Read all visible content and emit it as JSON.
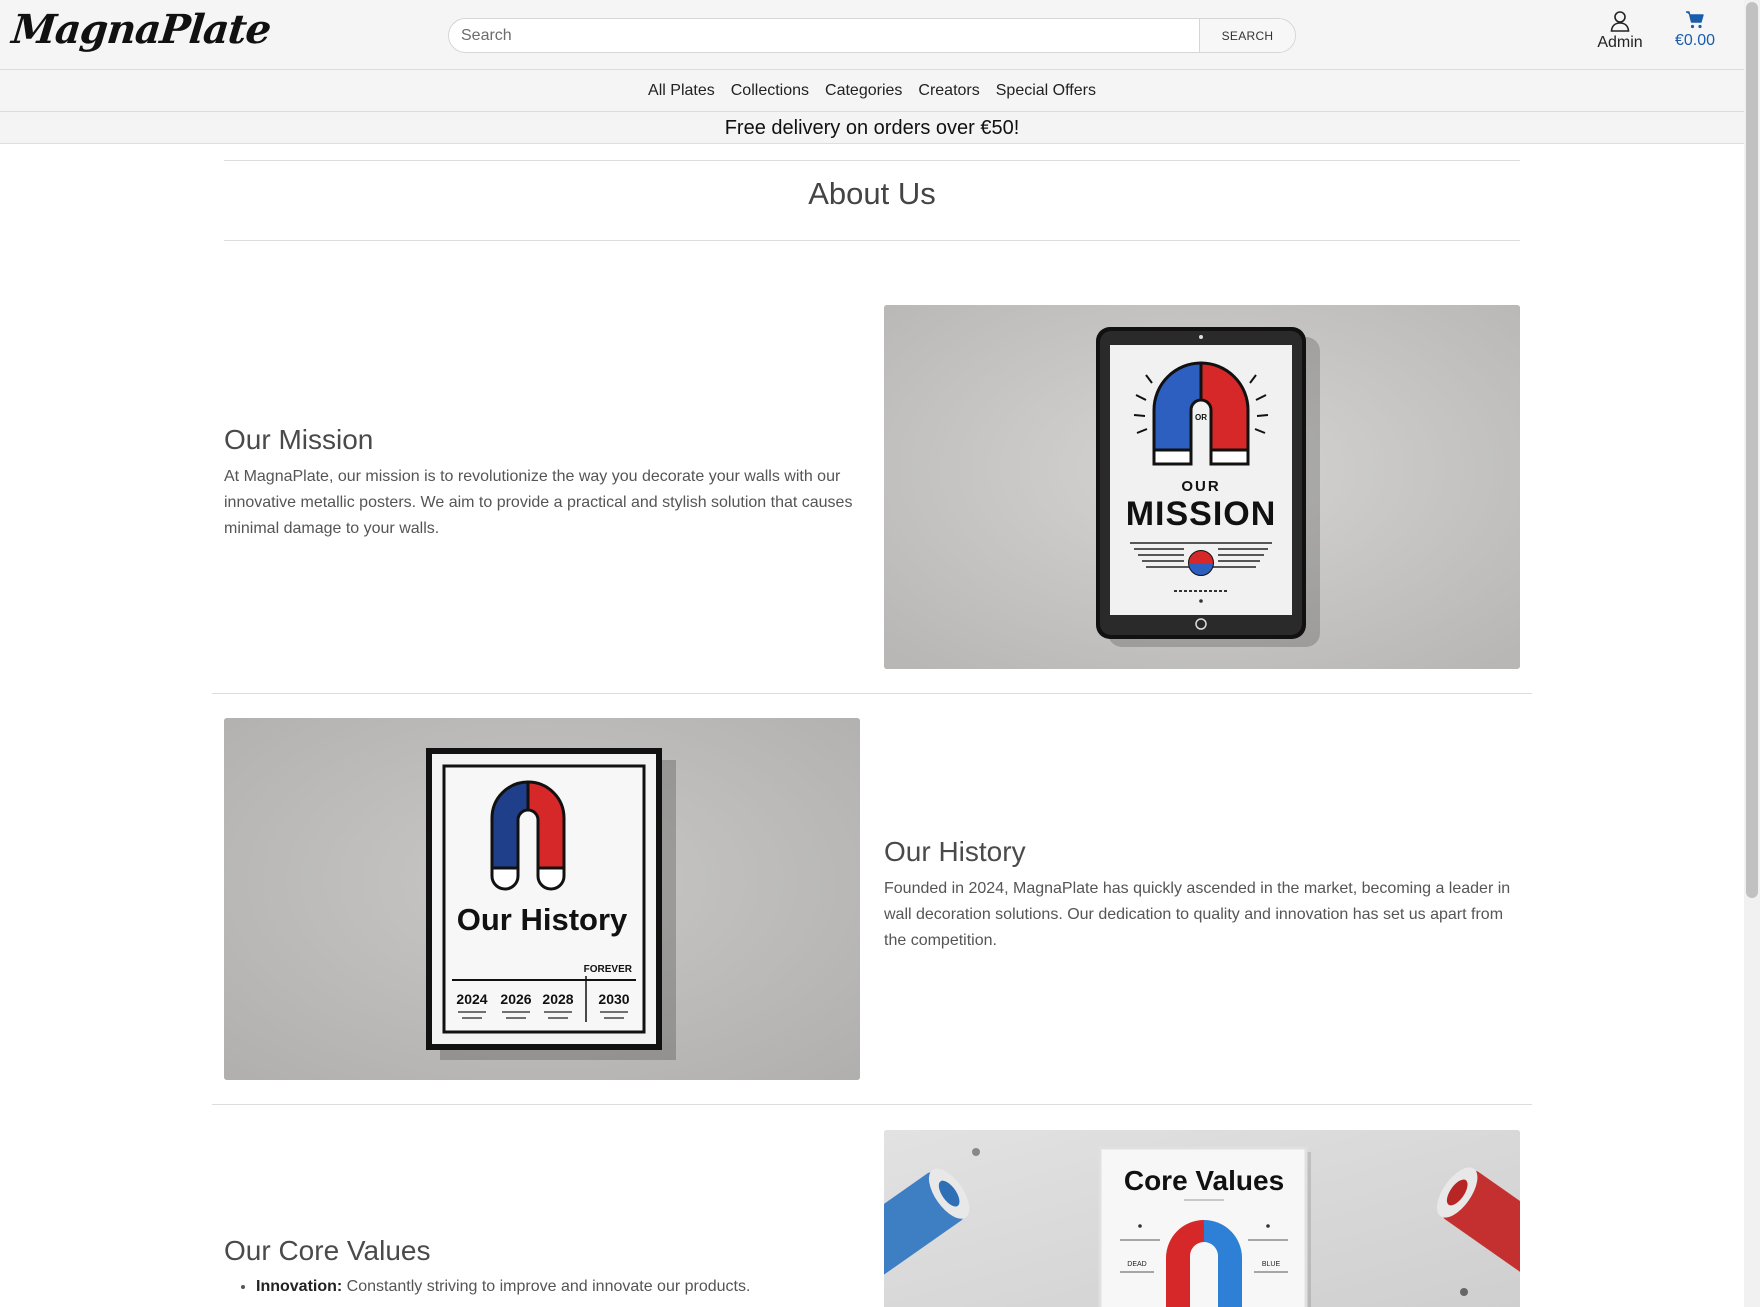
{
  "header": {
    "logo_text": "MagnaPlate",
    "search_placeholder": "Search",
    "search_button": "SEARCH",
    "account_label": "Admin",
    "cart_total": "€0.00"
  },
  "nav": {
    "items": [
      "All Plates",
      "Collections",
      "Categories",
      "Creators",
      "Special Offers"
    ]
  },
  "banner": {
    "text": "Free delivery on orders over €50!"
  },
  "page": {
    "title": "About Us"
  },
  "sections": [
    {
      "title": "Our Mission",
      "text": "At MagnaPlate, our mission is to revolutionize the way you decorate your walls with our innovative metallic posters. We aim to provide a practical and stylish solution that causes minimal damage to your walls.",
      "image": {
        "heading_small": "OUR",
        "heading_big": "MISSION",
        "center_label": "OR"
      }
    },
    {
      "title": "Our History",
      "text": "Founded in 2024, MagnaPlate has quickly ascended in the market, becoming a leader in wall decoration solutions. Our dedication to quality and innovation has set us apart from the competition.",
      "image": {
        "heading": "Our History",
        "forever_label": "FOREVER",
        "years": [
          "2024",
          "2026",
          "2028",
          "2030"
        ]
      }
    },
    {
      "title": "Our Core Values",
      "values": [
        {
          "term": "Innovation:",
          "desc": "Constantly striving to improve and innovate our products."
        }
      ],
      "image": {
        "heading": "Core Values",
        "left_label": "DEAD",
        "right_label": "BLUE"
      }
    }
  ],
  "colors": {
    "accent_blue": "#1a5dab",
    "magnet_red": "#d62828",
    "magnet_blue": "#1f4fa0",
    "panel_gray": "#bfbebc"
  },
  "icons": [
    "person-icon",
    "cart-icon"
  ]
}
